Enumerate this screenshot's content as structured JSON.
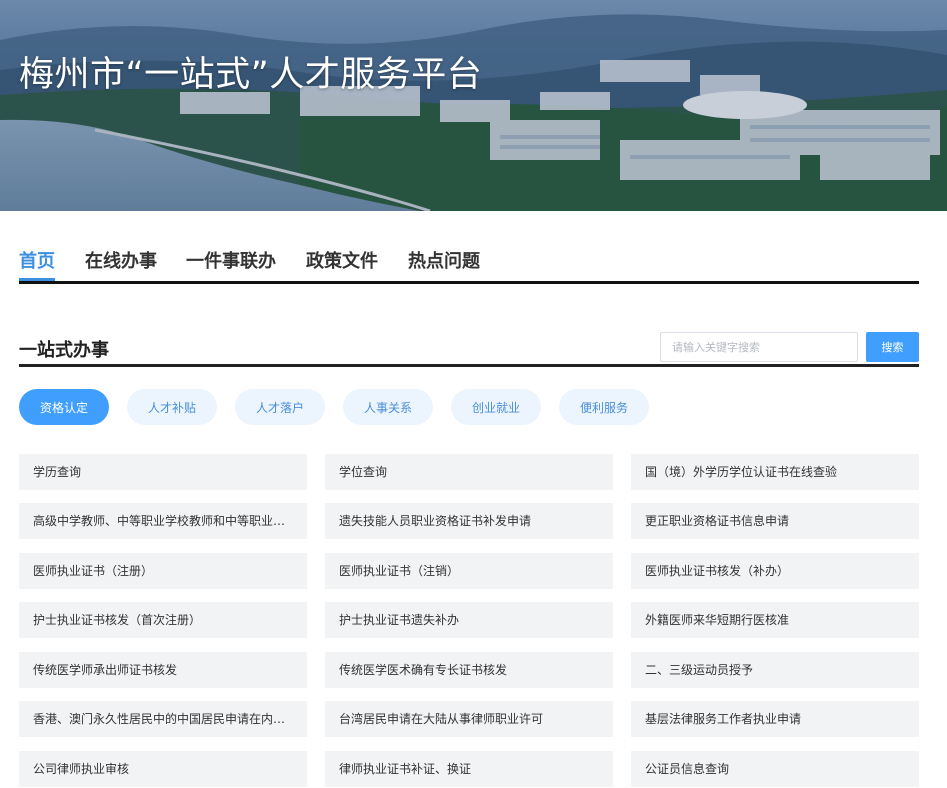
{
  "header": {
    "title": "梅州市“一站式”人才服务平台"
  },
  "nav": {
    "items": [
      {
        "label": "首页"
      },
      {
        "label": "在线办事"
      },
      {
        "label": "一件事联办"
      },
      {
        "label": "政策文件"
      },
      {
        "label": "热点问题"
      }
    ],
    "active_index": 0
  },
  "section": {
    "title": "一站式办事",
    "search_placeholder": "请输入关键字搜索",
    "search_button": "搜索"
  },
  "categories": {
    "items": [
      {
        "label": "资格认定"
      },
      {
        "label": "人才补贴"
      },
      {
        "label": "人才落户"
      },
      {
        "label": "人事关系"
      },
      {
        "label": "创业就业"
      },
      {
        "label": "便利服务"
      }
    ],
    "active_index": 0
  },
  "services": {
    "items": [
      {
        "label": "学历查询"
      },
      {
        "label": "学位查询"
      },
      {
        "label": "国（境）外学历学位认证书在线查验"
      },
      {
        "label": "高级中学教师、中等职业学校教师和中等职业学校实习指导教师资格认定"
      },
      {
        "label": "遗失技能人员职业资格证书补发申请"
      },
      {
        "label": "更正职业资格证书信息申请"
      },
      {
        "label": "医师执业证书（注册）"
      },
      {
        "label": "医师执业证书（注销）"
      },
      {
        "label": "医师执业证书核发（补办）"
      },
      {
        "label": "护士执业证书核发（首次注册）"
      },
      {
        "label": "护士执业证书遗失补办"
      },
      {
        "label": "外籍医师来华短期行医核准"
      },
      {
        "label": "传统医学师承出师证书核发"
      },
      {
        "label": "传统医学医术确有专长证书核发"
      },
      {
        "label": "二、三级运动员授予"
      },
      {
        "label": "香港、澳门永久性居民中的中国居民申请在内地从事律师职业许可"
      },
      {
        "label": "台湾居民申请在大陆从事律师职业许可"
      },
      {
        "label": "基层法律服务工作者执业申请"
      },
      {
        "label": "公司律师执业审核"
      },
      {
        "label": "律师执业证书补证、换证"
      },
      {
        "label": "公证员信息查询"
      }
    ]
  },
  "colors": {
    "accent": "#409eff",
    "pill_bg": "#ecf4fd",
    "cell_bg": "#f2f3f5"
  }
}
